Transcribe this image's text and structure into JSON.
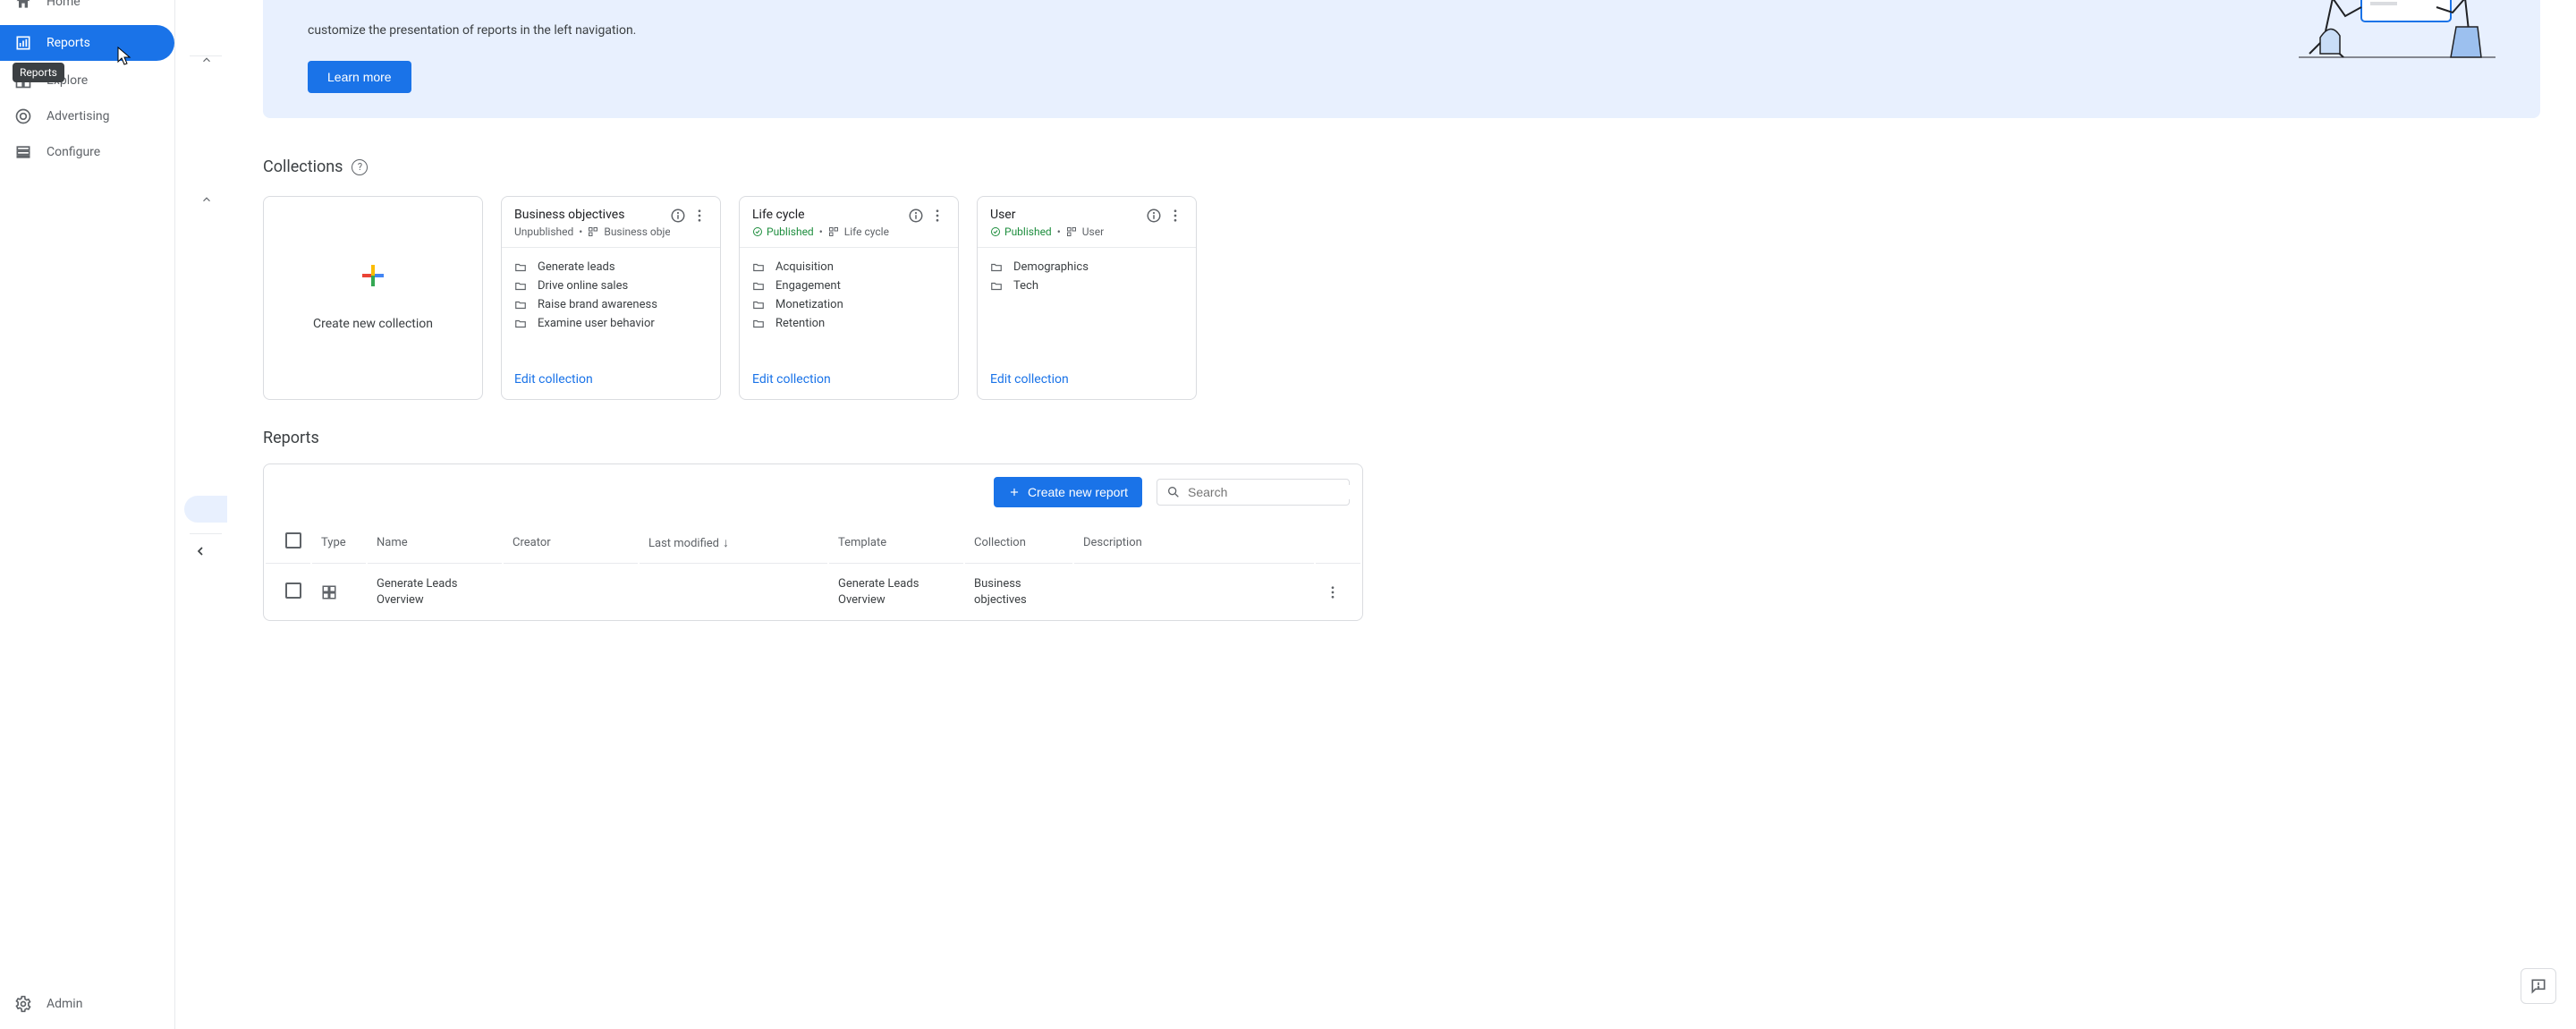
{
  "sidebar": {
    "items": [
      {
        "label": "Home"
      },
      {
        "label": "Reports"
      },
      {
        "label": "Explore"
      },
      {
        "label": "Advertising"
      },
      {
        "label": "Configure"
      }
    ],
    "admin_label": "Admin",
    "tooltip": "Reports"
  },
  "hero": {
    "text_line": "customize the presentation of reports in the left navigation.",
    "learn_more": "Learn more"
  },
  "collections": {
    "heading": "Collections",
    "create_label": "Create new collection",
    "edit_label": "Edit collection",
    "cards": [
      {
        "title": "Business objectives",
        "status": "Unpublished",
        "template": "Business object...",
        "published": false,
        "items": [
          "Generate leads",
          "Drive online sales",
          "Raise brand awareness",
          "Examine user behavior"
        ]
      },
      {
        "title": "Life cycle",
        "status": "Published",
        "template": "Life cycle",
        "published": true,
        "items": [
          "Acquisition",
          "Engagement",
          "Monetization",
          "Retention"
        ]
      },
      {
        "title": "User",
        "status": "Published",
        "template": "User",
        "published": true,
        "items": [
          "Demographics",
          "Tech"
        ]
      }
    ]
  },
  "reports": {
    "heading": "Reports",
    "create_button": "Create new report",
    "search_placeholder": "Search",
    "columns": {
      "type": "Type",
      "name": "Name",
      "creator": "Creator",
      "last_modified": "Last modified",
      "template": "Template",
      "collection": "Collection",
      "description": "Description"
    },
    "rows": [
      {
        "name": "Generate Leads Overview",
        "creator": "",
        "last_modified": "",
        "template": "Generate Leads Overview",
        "collection": "Business objectives",
        "description": ""
      }
    ]
  }
}
